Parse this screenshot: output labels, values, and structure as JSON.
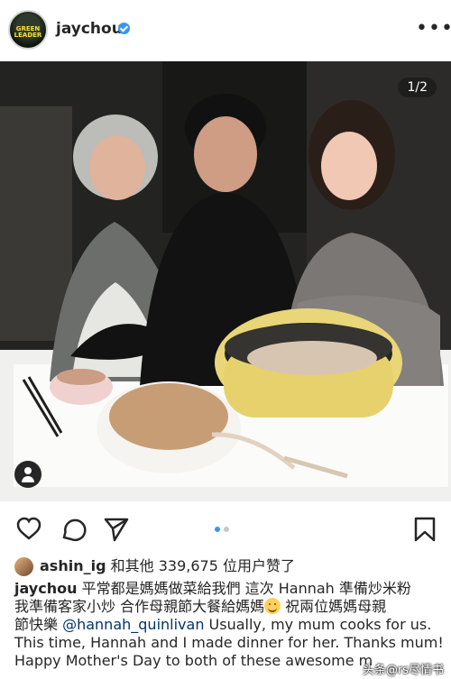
{
  "header": {
    "username": "jaychou",
    "avatar_text": "GREEN LEADER"
  },
  "photo": {
    "counter": "1/2",
    "photo_alt": "Family dinner photo with food on the table"
  },
  "actions": {
    "heart": "heart-icon",
    "comment": "comment-icon",
    "share": "share-icon",
    "bookmark": "bookmark-icon"
  },
  "likes": {
    "user": "ashin_ig",
    "text": " 和其他 339,675 位用户赞了"
  },
  "caption": {
    "user": "jaychou",
    "line1": " 平常都是媽媽做菜給我們 這次 Hannah 準備炒米粉",
    "line2": "我準備客家小炒 合作母親節大餐給媽媽",
    "line2b": " 祝兩位媽媽母親",
    "line3a": "節快樂 ",
    "mention": "@hannah_quinlivan",
    "line3b": " Usually, my mum cooks for us.",
    "line4": "This time, Hannah and I made dinner for her. Thanks mum!",
    "line5": "Happy Mother's Day to both of these awesome m"
  },
  "watermark": "头条@rs尽情书"
}
